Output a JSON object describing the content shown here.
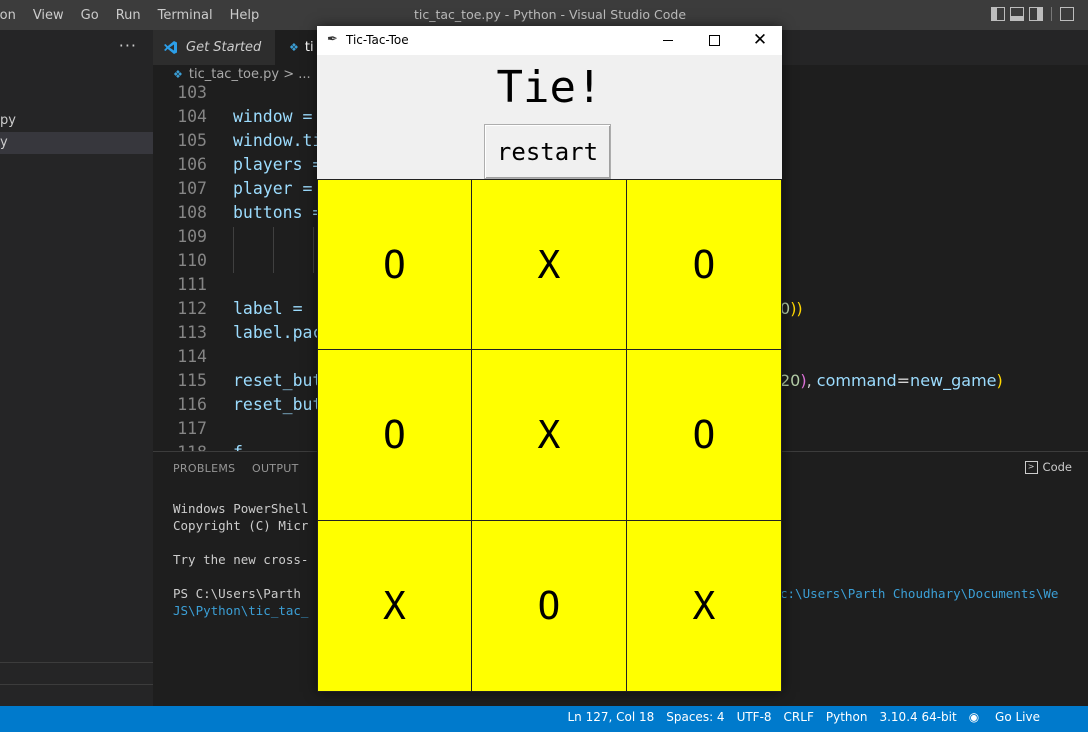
{
  "vscode": {
    "menu": [
      "ion",
      "View",
      "Go",
      "Run",
      "Terminal",
      "Help"
    ],
    "window_title": "tic_tac_toe.py - Python - Visual Studio Code",
    "sidebar": {
      "more_label": "···",
      "items": [
        "py",
        "y"
      ]
    },
    "tabs": [
      {
        "label": "Get Started"
      },
      {
        "label": "ti"
      }
    ],
    "breadcrumb": "tic_tac_toe.py > ...",
    "code_lines": [
      {
        "num": "103",
        "text": ""
      },
      {
        "num": "104",
        "text": "window ="
      },
      {
        "num": "105",
        "text": "window.ti"
      },
      {
        "num": "106",
        "text": "players ="
      },
      {
        "num": "107",
        "text": "player ="
      },
      {
        "num": "108",
        "text": "buttons ="
      },
      {
        "num": "109",
        "text": ""
      },
      {
        "num": "110",
        "text": ""
      },
      {
        "num": "111",
        "text": ""
      },
      {
        "num": "112",
        "text": "label = "
      },
      {
        "num": "113",
        "text": "label.pac"
      },
      {
        "num": "114",
        "text": ""
      },
      {
        "num": "115",
        "text": "reset_but"
      },
      {
        "num": "116",
        "text": "reset_but"
      },
      {
        "num": "117",
        "text": ""
      },
      {
        "num": "118",
        "text": "f"
      }
    ],
    "code_tails": {
      "line112": "0))",
      "line115_num": "20), ",
      "line115_kw": "command",
      "line115_eq": "=",
      "line115_fn": "new_game",
      "line115_end": ")"
    },
    "panel": {
      "tabs": [
        "PROBLEMS",
        "OUTPUT"
      ],
      "terminal_label": "Code",
      "terminal_lines": [
        "Windows PowerShell",
        "Copyright (C) Micr",
        "",
        "Try the new cross-",
        "",
        "PS C:\\Users\\Parth",
        ""
      ],
      "blue_line_1": "c:\\Users\\Parth Choudhary\\Documents\\We",
      "blue_line_2": "JS\\Python\\tic_tac_"
    },
    "status": [
      "Ln 127, Col 18",
      "Spaces: 4",
      "UTF-8",
      "CRLF",
      "Python",
      "3.10.4 64-bit",
      "Go Live"
    ]
  },
  "tk_window": {
    "title": "Tic-Tac-Toe",
    "label": "Tie!",
    "restart_label": "restart",
    "cell_color": "#ffff00",
    "board": [
      [
        "O",
        "X",
        "O"
      ],
      [
        "O",
        "X",
        "O"
      ],
      [
        "X",
        "O",
        "X"
      ]
    ]
  }
}
